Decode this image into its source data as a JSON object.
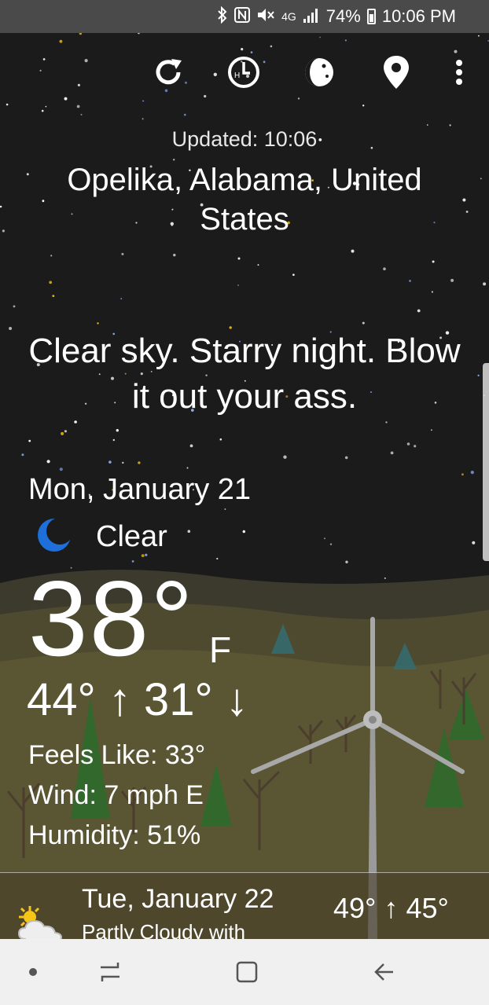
{
  "status_bar": {
    "network": "4G",
    "battery": "74%",
    "time": "10:06 PM",
    "icons": [
      "bluetooth-icon",
      "nfc-icon",
      "vibrate-mute-icon",
      "lte-icon",
      "signal-icon",
      "battery-icon"
    ]
  },
  "toolbar": {
    "buttons": [
      "refresh-icon",
      "hourly-clock-icon",
      "moon-phase-icon",
      "location-pin-icon",
      "overflow-menu-icon"
    ]
  },
  "header": {
    "updated": "Updated: 10:06",
    "location": "Opelika, Alabama, United States"
  },
  "quip": "Clear sky. Starry night. Blow it out your ass.",
  "today": {
    "date": "Mon, January 21",
    "condition": "Clear",
    "condition_icon": "crescent-moon-icon",
    "temp": "38°",
    "unit": "F",
    "hilo": "44° ↑ 31° ↓",
    "feels_like": "Feels Like: 33°",
    "wind": "Wind: 7 mph E",
    "humidity": "Humidity: 51%"
  },
  "next_day": {
    "date": "Tue, January 22",
    "description": "Partly Cloudy with",
    "temps": "49° ↑ 45°",
    "icon": "partly-cloudy-icon"
  },
  "nav_bar": {
    "buttons": [
      "dot-indicator-icon",
      "recents-icon",
      "home-icon",
      "back-icon"
    ]
  },
  "colors": {
    "sky": "#1b1b1b",
    "ground": "#5a5532",
    "moon": "#1e6fd9",
    "status_bar": "#4a4a4a",
    "nav_bar": "#f0f0f0"
  }
}
